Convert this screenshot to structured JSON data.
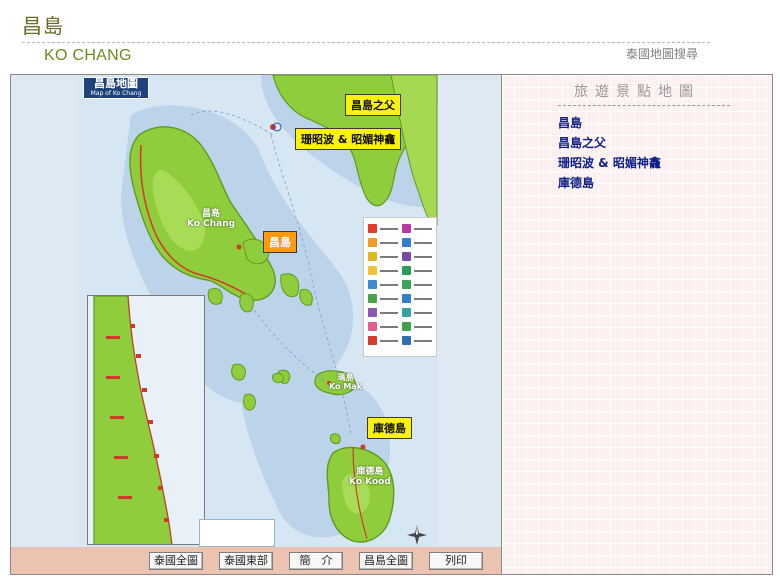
{
  "header": {
    "title": "昌島",
    "subtitle": "KO CHANG",
    "search_link": "泰國地圖搜尋"
  },
  "map": {
    "logo_cn": "昌島地圖",
    "logo_en": "Map of Ko Chang",
    "callouts": {
      "father": "昌島之父",
      "coral": "珊昭波 & 昭媚神龕",
      "changdao": "昌島",
      "kood": "庫德島"
    },
    "labels": {
      "chang_cn": "昌島",
      "chang_en": "Ko Chang",
      "mak_cn": "瑪島",
      "mak_en": "Ko Mak",
      "kood_cn": "庫德島",
      "kood_en": "Ko Kood"
    },
    "colors": {
      "sea": "#e6eef6",
      "shallow": "#bcd3ea",
      "land": "#8fcd3c",
      "land_edge": "#5f9b22",
      "road": "#d23a28"
    }
  },
  "nav": {
    "buttons": [
      "泰國全圖",
      "泰國東部",
      "簡　介",
      "昌島全圖",
      "列印"
    ]
  },
  "sidebar": {
    "heading": "旅遊景點地圖",
    "items": [
      "昌島",
      "昌島之父",
      "珊昭波 & 昭媚神龕",
      "庫德島"
    ]
  }
}
